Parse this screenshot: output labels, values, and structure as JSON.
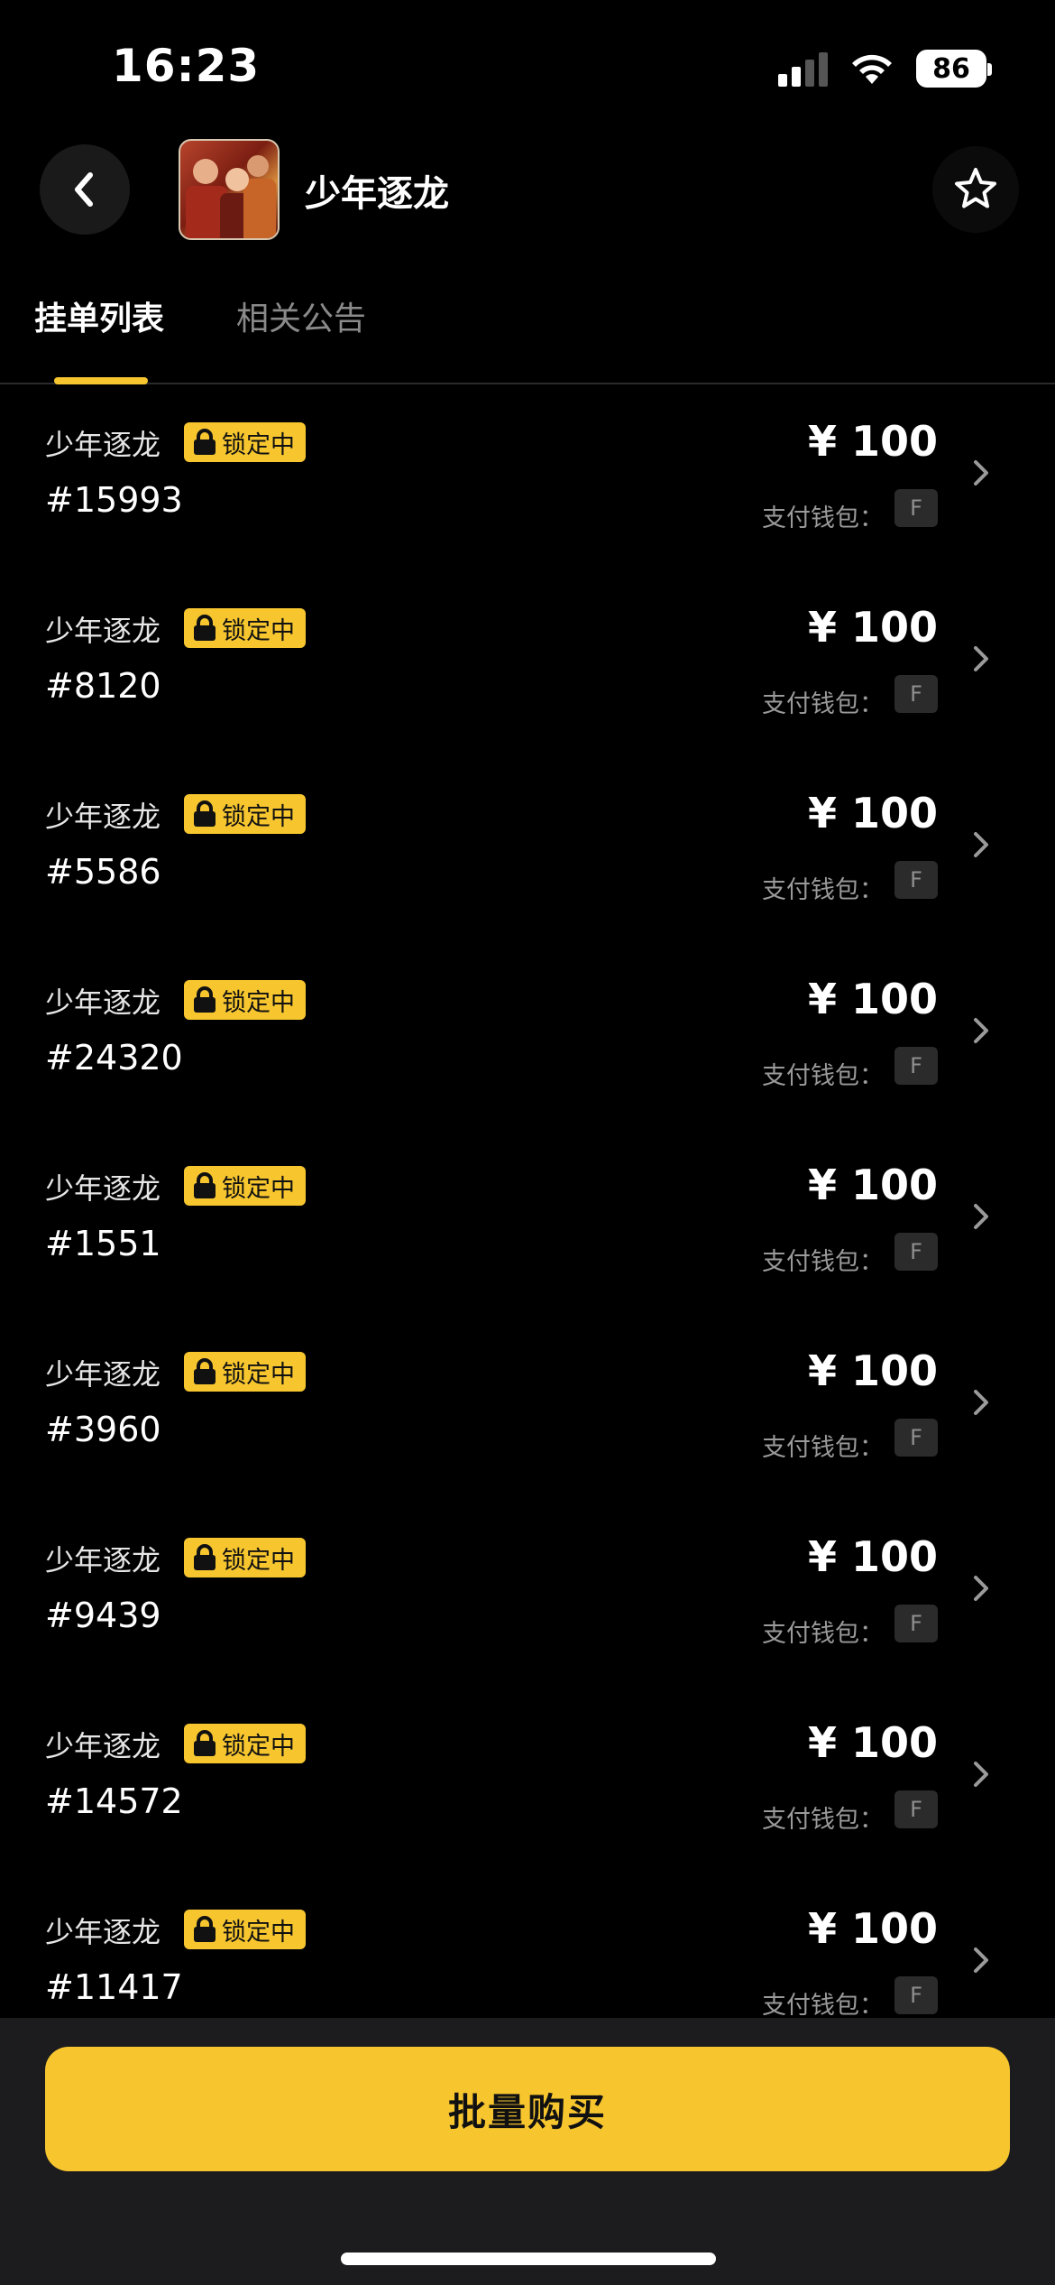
{
  "status_bar": {
    "time": "16:23",
    "battery": "86"
  },
  "header": {
    "title": "少年逐龙"
  },
  "tabs": [
    {
      "label": "挂单列表",
      "active": true
    },
    {
      "label": "相关公告",
      "active": false
    }
  ],
  "listings": [
    {
      "name": "少年逐龙",
      "status": "锁定中",
      "id": "#15993",
      "price": "¥ 100",
      "wallet_label": "支付钱包：",
      "wallet": "F"
    },
    {
      "name": "少年逐龙",
      "status": "锁定中",
      "id": "#8120",
      "price": "¥ 100",
      "wallet_label": "支付钱包：",
      "wallet": "F"
    },
    {
      "name": "少年逐龙",
      "status": "锁定中",
      "id": "#5586",
      "price": "¥ 100",
      "wallet_label": "支付钱包：",
      "wallet": "F"
    },
    {
      "name": "少年逐龙",
      "status": "锁定中",
      "id": "#24320",
      "price": "¥ 100",
      "wallet_label": "支付钱包：",
      "wallet": "F"
    },
    {
      "name": "少年逐龙",
      "status": "锁定中",
      "id": "#1551",
      "price": "¥ 100",
      "wallet_label": "支付钱包：",
      "wallet": "F"
    },
    {
      "name": "少年逐龙",
      "status": "锁定中",
      "id": "#3960",
      "price": "¥ 100",
      "wallet_label": "支付钱包：",
      "wallet": "F"
    },
    {
      "name": "少年逐龙",
      "status": "锁定中",
      "id": "#9439",
      "price": "¥ 100",
      "wallet_label": "支付钱包：",
      "wallet": "F"
    },
    {
      "name": "少年逐龙",
      "status": "锁定中",
      "id": "#14572",
      "price": "¥ 100",
      "wallet_label": "支付钱包：",
      "wallet": "F"
    },
    {
      "name": "少年逐龙",
      "status": "锁定中",
      "id": "#11417",
      "price": "¥ 100",
      "wallet_label": "支付钱包：",
      "wallet": "F"
    }
  ],
  "bottom": {
    "bulk_buy_label": "批量购买"
  },
  "icons": {
    "back": "chevron-left-icon",
    "favorite": "star-icon",
    "lock": "lock-icon",
    "row_chevron": "chevron-right-icon",
    "wifi": "wifi-icon",
    "signal": "cellular-signal-icon",
    "battery": "battery-icon"
  },
  "colors": {
    "accent": "#f7c62f",
    "background": "#000000",
    "bottom_bar": "#1c1c1e"
  }
}
